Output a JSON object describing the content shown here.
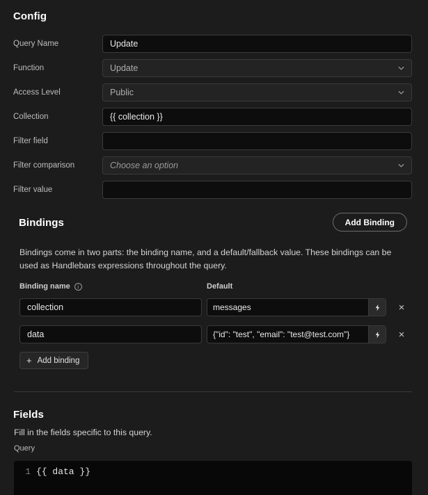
{
  "config": {
    "title": "Config",
    "fields": [
      {
        "label": "Query Name",
        "type": "input",
        "value": "Update",
        "placeholder": ""
      },
      {
        "label": "Function",
        "type": "select",
        "value": "Update",
        "placeholder": ""
      },
      {
        "label": "Access Level",
        "type": "select",
        "value": "Public",
        "placeholder": ""
      },
      {
        "label": "Collection",
        "type": "input",
        "value": "{{ collection }}",
        "placeholder": ""
      },
      {
        "label": "Filter field",
        "type": "input",
        "value": "",
        "placeholder": ""
      },
      {
        "label": "Filter comparison",
        "type": "select",
        "value": "Choose an option",
        "placeholder": "",
        "is_placeholder": true
      },
      {
        "label": "Filter value",
        "type": "input",
        "value": "",
        "placeholder": ""
      }
    ]
  },
  "bindings": {
    "title": "Bindings",
    "add_binding_pill_label": "Add Binding",
    "description": "Bindings come in two parts: the binding name, and a default/fallback value. These bindings can be used as Handlebars expressions throughout the query.",
    "column_headers": {
      "name": "Binding name",
      "default": "Default"
    },
    "info_icon_glyph": "i",
    "rows": [
      {
        "name": "collection",
        "default": "messages"
      },
      {
        "name": "data",
        "default": "{\"id\": \"test\", \"email\": \"test@test.com\"}"
      }
    ],
    "bolt_icon": "lightning-bolt-icon",
    "remove_icon": "×",
    "add_binding_label": "Add binding",
    "add_binding_plus": "+"
  },
  "fields": {
    "title": "Fields",
    "description": "Fill in the fields specific to this query.",
    "query_label": "Query",
    "editor": {
      "line_number": "1",
      "code": "{{ data }}"
    }
  },
  "colors": {
    "page_background": "#1c1c1c",
    "input_background": "#0d0d0d",
    "select_background": "#232323",
    "border": "#3a3a3a",
    "text_primary": "#ffffff",
    "text_secondary": "#bdbdbd",
    "editor_background": "#080808"
  }
}
